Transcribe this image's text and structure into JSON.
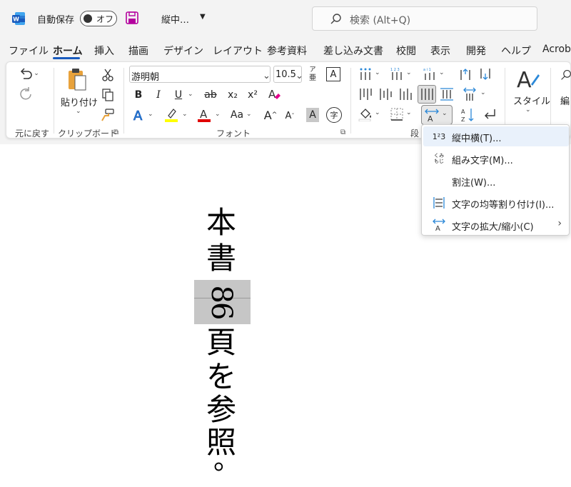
{
  "title_bar": {
    "autosave_label": "自動保存",
    "toggle_text": "オフ",
    "doc_title": "縦中…",
    "search_placeholder": "検索 (Alt+Q)"
  },
  "tabs": [
    "ファイル",
    "ホーム",
    "挿入",
    "描画",
    "デザイン",
    "レイアウト",
    "参考資料",
    "差し込み文書",
    "校閲",
    "表示",
    "開発",
    "ヘルプ",
    "Acrob"
  ],
  "active_tab": "ホーム",
  "ribbon": {
    "undo_group_label": "元に戻す",
    "clipboard": {
      "paste_label": "貼り付け",
      "group_label": "クリップボード"
    },
    "font": {
      "name": "游明朝",
      "size": "10.5",
      "group_label": "フォント",
      "bold": "B",
      "italic": "I",
      "underline": "U",
      "strike": "ab",
      "sub": "x₂",
      "sup": "x²",
      "case": "Aa",
      "grow": "A",
      "shrink": "A",
      "char_shade": "A",
      "enclose": "字",
      "ruby_top": "ア",
      "ruby_bottom": "亜",
      "box": "A"
    },
    "paragraph": {
      "group_label": "段"
    },
    "styles": {
      "label": "スタイル"
    },
    "editing": {
      "label": "編"
    }
  },
  "document": {
    "chars_before": [
      "本",
      "書"
    ],
    "tcy_text": "86",
    "chars_after": [
      "頁",
      "を",
      "参",
      "照",
      "。"
    ]
  },
  "dropdown": {
    "items": [
      {
        "label": "縦中横(T)...",
        "icon": "tate-chu-yoko-icon",
        "icon_text": "1²3",
        "has_submenu": false
      },
      {
        "label": "組み文字(M)...",
        "icon": "kumimoji-icon",
        "icon_text": "くみもじ",
        "has_submenu": false
      },
      {
        "label": "割注(W)...",
        "icon": "",
        "icon_text": "",
        "has_submenu": false
      },
      {
        "label": "文字の均等割り付け(I)...",
        "icon": "distribute-icon",
        "icon_text": "",
        "has_submenu": false
      },
      {
        "label": "文字の拡大/縮小(C)",
        "icon": "char-scale-icon",
        "icon_text": "",
        "has_submenu": true
      }
    ]
  },
  "colors": {
    "accent": "#185abd",
    "highlight_yellow": "#ffff00",
    "font_red": "#e00000",
    "word_blue": "#185abd",
    "save_purple": "#b4009e"
  }
}
